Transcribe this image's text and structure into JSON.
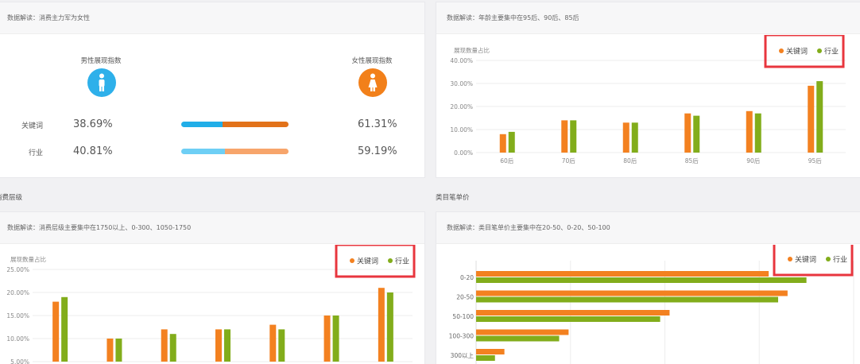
{
  "colors": {
    "keyword": "#f38120",
    "industry": "#82ad1b",
    "male": "#2eb0ea",
    "female": "#f2801a",
    "male_bar_kw": "#21aee8",
    "female_bar_kw": "#e2721a",
    "male_bar_ind": "#6ecff5",
    "female_bar_ind": "#f7a56b",
    "highlight": "#e8363e"
  },
  "gender": {
    "header": "数据解读：消费主力军为女性",
    "male_title": "男性展现指数",
    "female_title": "女性展现指数",
    "male_icon": "male-person-icon",
    "female_icon": "female-person-icon",
    "rows": [
      {
        "label": "关键词",
        "male": "38.69%",
        "female": "61.31%",
        "male_share": 0.3869
      },
      {
        "label": "行业",
        "male": "40.81%",
        "female": "59.19%",
        "male_share": 0.4081
      }
    ]
  },
  "sections": {
    "consumption": "消费层级",
    "category": "类目笔单价"
  },
  "chart_data": [
    {
      "id": "age",
      "type": "bar",
      "header": "数据解读：年龄主要集中在95后、90后、85后",
      "ylabel": "展现数量占比",
      "categories": [
        "60后",
        "70后",
        "80后",
        "85后",
        "90后",
        "95后"
      ],
      "series": [
        {
          "name": "关键词",
          "values": [
            8,
            14,
            13,
            17,
            18,
            29
          ]
        },
        {
          "name": "行业",
          "values": [
            9,
            14,
            13,
            16,
            17,
            31
          ]
        }
      ],
      "ylim": [
        0,
        40
      ],
      "yticks": [
        "0.00%",
        "10.00%",
        "20.00%",
        "30.00%",
        "40.00%"
      ],
      "legend": "top-right"
    },
    {
      "id": "consumption",
      "type": "bar",
      "header": "数据解读：消费层级主要集中在1750以上、0-300、1050-1750",
      "ylabel": "展现数量占比",
      "series": [
        {
          "name": "关键词",
          "values": [
            18,
            10,
            12,
            12,
            13,
            15,
            21
          ]
        },
        {
          "name": "行业",
          "values": [
            19,
            10,
            11,
            12,
            12,
            15,
            20
          ]
        }
      ],
      "ylim": [
        5,
        25
      ],
      "yticks": [
        "5.00%",
        "10.00%",
        "15.00%",
        "20.00%",
        "25.00%"
      ],
      "legend": "top-right"
    },
    {
      "id": "category",
      "type": "bar",
      "orientation": "horizontal",
      "header": "数据解读：类目笔单价主要集中在20-50、0-20、50-100",
      "categories": [
        "0-20",
        "20-50",
        "50-100",
        "100-300",
        "300以上"
      ],
      "series": [
        {
          "name": "关键词",
          "values": [
            31,
            33,
            20.5,
            9.8,
            3
          ]
        },
        {
          "name": "行业",
          "values": [
            35,
            32,
            19.5,
            8.8,
            2
          ]
        }
      ],
      "xlim": [
        0,
        40
      ],
      "legend": "top-right"
    }
  ]
}
